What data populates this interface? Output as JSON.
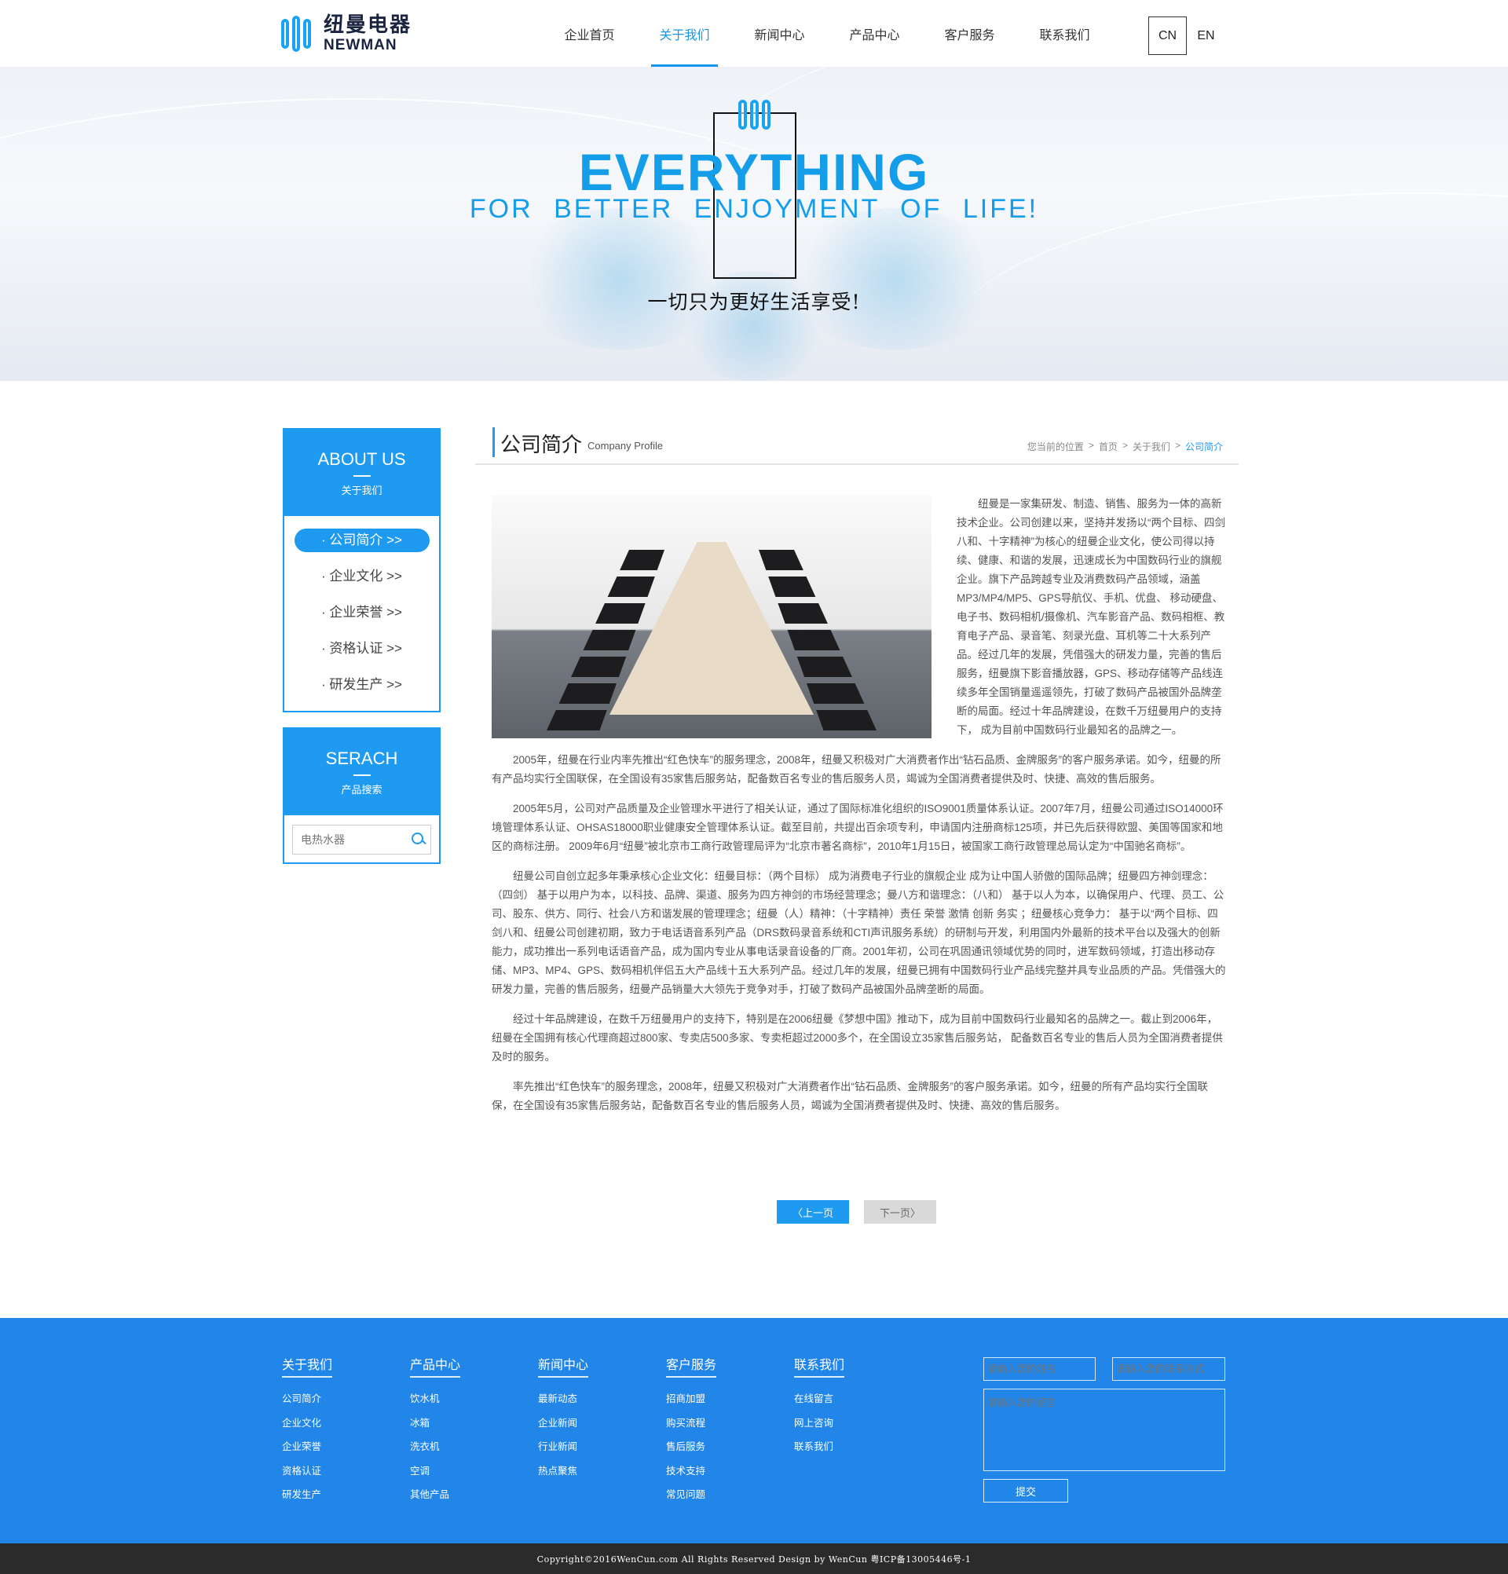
{
  "brand": {
    "name_cn": "纽曼电器",
    "name_en": "NEWMAN",
    "accent": "#1e9af0"
  },
  "nav": {
    "items": [
      "企业首页",
      "关于我们",
      "新闻中心",
      "产品中心",
      "客户服务",
      "联系我们"
    ],
    "active_index": 1
  },
  "lang": {
    "cn": "CN",
    "en": "EN",
    "selected": "CN"
  },
  "banner": {
    "headline": "EVERYTHING",
    "subline": "FOR BETTER ENJOYMENT OF LIFE!",
    "slogan_cn": "一切只为更好生活享受!"
  },
  "sidebar": {
    "about": {
      "title": "ABOUT US",
      "subtitle": "关于我们",
      "items": [
        "· 公司简介 >>",
        "· 企业文化 >>",
        "· 企业荣誉 >>",
        "· 资格认证 >>",
        "· 研发生产 >>"
      ],
      "active_index": 0
    },
    "search": {
      "title": "SERACH",
      "subtitle": "产品搜索",
      "placeholder": "电热水器"
    }
  },
  "main": {
    "title": "公司简介",
    "title_en": "Company Profile",
    "breadcrumb": [
      "您当前的位置",
      "首页",
      "关于我们",
      "公司简介"
    ],
    "paragraphs": [
      "纽曼是一家集研发、制造、销售、服务为一体的高新技术企业。公司创建以来，坚持并发扬以“两个目标、四剑八和、十字精神”为核心的纽曼企业文化，使公司得以持续、健康、和谐的发展，迅速成长为中国数码行业的旗舰企业。旗下产品跨越专业及消费数码产品领域，涵盖MP3/MP4/MP5、GPS导航仪、手机、优盘、 移动硬盘、电子书、数码相机/摄像机、汽车影音产品、数码相框、教育电子产品、录音笔、刻录光盘、耳机等二十大系列产品。经过几年的发展，凭借强大的研发力量，完善的售后服务，纽曼旗下影音播放器，GPS、移动存储等产品线连续多年全国销量遥遥领先，打破了数码产品被国外品牌垄断的局面。经过十年品牌建设，在数千万纽曼用户的支持下， 成为目前中国数码行业最知名的品牌之一。",
      "2005年，纽曼在行业内率先推出“红色快车”的服务理念，2008年，纽曼又积极对广大消费者作出“钻石品质、金牌服务”的客户服务承诺。如今，纽曼的所有产品均实行全国联保，在全国设有35家售后服务站，配备数百名专业的售后服务人员，竭诚为全国消费者提供及时、快捷、高效的售后服务。",
      "2005年5月，公司对产品质量及企业管理水平进行了相关认证，通过了国际标准化组织的ISO9001质量体系认证。2007年7月，纽曼公司通过ISO14000环境管理体系认证、OHSAS18000职业健康安全管理体系认证。截至目前，共提出百余项专利，申请国内注册商标125项，并已先后获得欧盟、美国等国家和地区的商标注册。 2009年6月“纽曼”被北京市工商行政管理局评为“北京市著名商标”，2010年1月15日，被国家工商行政管理总局认定为“中国驰名商标”。",
      "纽曼公司自创立起多年秉承核心企业文化：纽曼目标：（两个目标） 成为消费电子行业的旗舰企业 成为让中国人骄傲的国际品牌；纽曼四方神剑理念：（四剑） 基于以用户为本，以科技、品牌、渠道、服务为四方神剑的市场经营理念；曼八方和谐理念：（八和） 基于以人为本，以确保用户、代理、员工、公司、股东、供方、同行、社会八方和谐发展的管理理念；纽曼（人）精神：（十字精神）责任 荣誉 激情 创新 务实 ；纽曼核心竞争力： 基于以“两个目标、四剑八和、纽曼公司创建初期，致力于电话语音系列产品（DRS数码录音系统和CTI声讯服务系统）的研制与开发，利用国内外最新的技术平台以及强大的创新能力，成功推出一系列电话语音产品，成为国内专业从事电话录音设备的厂商。2001年初，公司在巩固通讯领域优势的同时，进军数码领域，打造出移动存储、MP3、MP4、GPS、数码相机伴侣五大产品线十五大系列产品。经过几年的发展，纽曼已拥有中国数码行业产品线完整并具专业品质的产品。凭借强大的研发力量，完善的售后服务，纽曼产品销量大大领先于竞争对手，打破了数码产品被国外品牌垄断的局面。",
      "经过十年品牌建设，在数千万纽曼用户的支持下，特别是在2006纽曼《梦想中国》推动下，成为目前中国数码行业最知名的品牌之一。截止到2006年，纽曼在全国拥有核心代理商超过800家、专卖店500多家、专卖柜超过2000多个，在全国设立35家售后服务站， 配备数百名专业的售后人员为全国消费者提供及时的服务。",
      "率先推出“红色快车”的服务理念，2008年，纽曼又积极对广大消费者作出“钻石品质、金牌服务”的客户服务承诺。如今，纽曼的所有产品均实行全国联保，在全国设有35家售后服务站，配备数百名专业的售后服务人员，竭诚为全国消费者提供及时、快捷、高效的售后服务。"
    ],
    "pager": {
      "prev": "〈上一页",
      "next": "下一页〉"
    }
  },
  "footer": {
    "columns": [
      {
        "title": "关于我们",
        "links": [
          "公司简介",
          "企业文化",
          "企业荣誉",
          "资格认证",
          "研发生产"
        ]
      },
      {
        "title": "产品中心",
        "links": [
          "饮水机",
          "冰箱",
          "洗衣机",
          "空调",
          "其他产品"
        ]
      },
      {
        "title": "新闻中心",
        "links": [
          "最新动态",
          "企业新闻",
          "行业新闻",
          "热点聚焦"
        ]
      },
      {
        "title": "客户服务",
        "links": [
          "招商加盟",
          "购买流程",
          "售后服务",
          "技术支持",
          "常见问题"
        ]
      },
      {
        "title": "联系我们",
        "links": [
          "在线留言",
          "网上咨询",
          "联系我们"
        ]
      }
    ],
    "form": {
      "name_placeholder": "请输入您的姓名",
      "contact_placeholder": "请输入您的联系方式",
      "message_placeholder": "请输入您的留言",
      "submit": "提交"
    },
    "copyright": "Copyright©2016WenCun.com All Rights Reserved Design by WenCun 粤ICP备13005446号-1",
    "bg_color": "#2186e8"
  }
}
